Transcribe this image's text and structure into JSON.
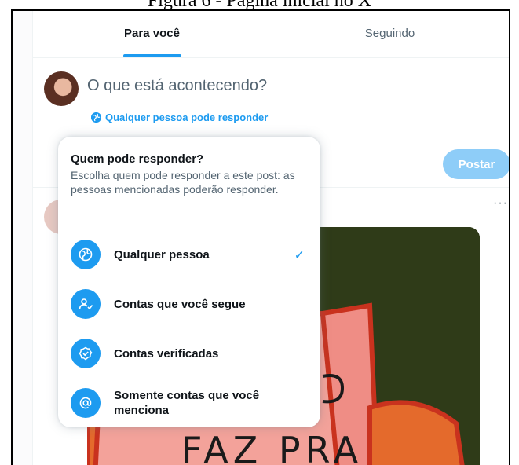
{
  "caption": "Figura 6 - Página inicial no X",
  "tabs": [
    {
      "label": "Para você",
      "active": true
    },
    {
      "label": "Seguindo",
      "active": false
    }
  ],
  "composer": {
    "placeholder": "O que está acontecendo?",
    "reply_setting": "Qualquer pessoa pode responder",
    "post_label": "Postar"
  },
  "post": {
    "more_label": "···",
    "image_text": "FAZ PRA"
  },
  "reply_menu": {
    "title": "Quem pode responder?",
    "description": "Escolha quem pode responder a este post: as pessoas mencionadas poderão responder.",
    "options": [
      {
        "label": "Qualquer pessoa",
        "icon": "globe-icon",
        "selected": true
      },
      {
        "label": "Contas que você segue",
        "icon": "person-check-icon",
        "selected": false
      },
      {
        "label": "Contas verificadas",
        "icon": "verified-badge-icon",
        "selected": false
      },
      {
        "label": "Somente contas que você menciona",
        "icon": "at-sign-icon",
        "selected": false
      }
    ],
    "check_glyph": "✓"
  },
  "colors": {
    "accent": "#1d9bf0",
    "post_button_disabled": "#8ecdf8",
    "secondary_text": "#536471"
  }
}
